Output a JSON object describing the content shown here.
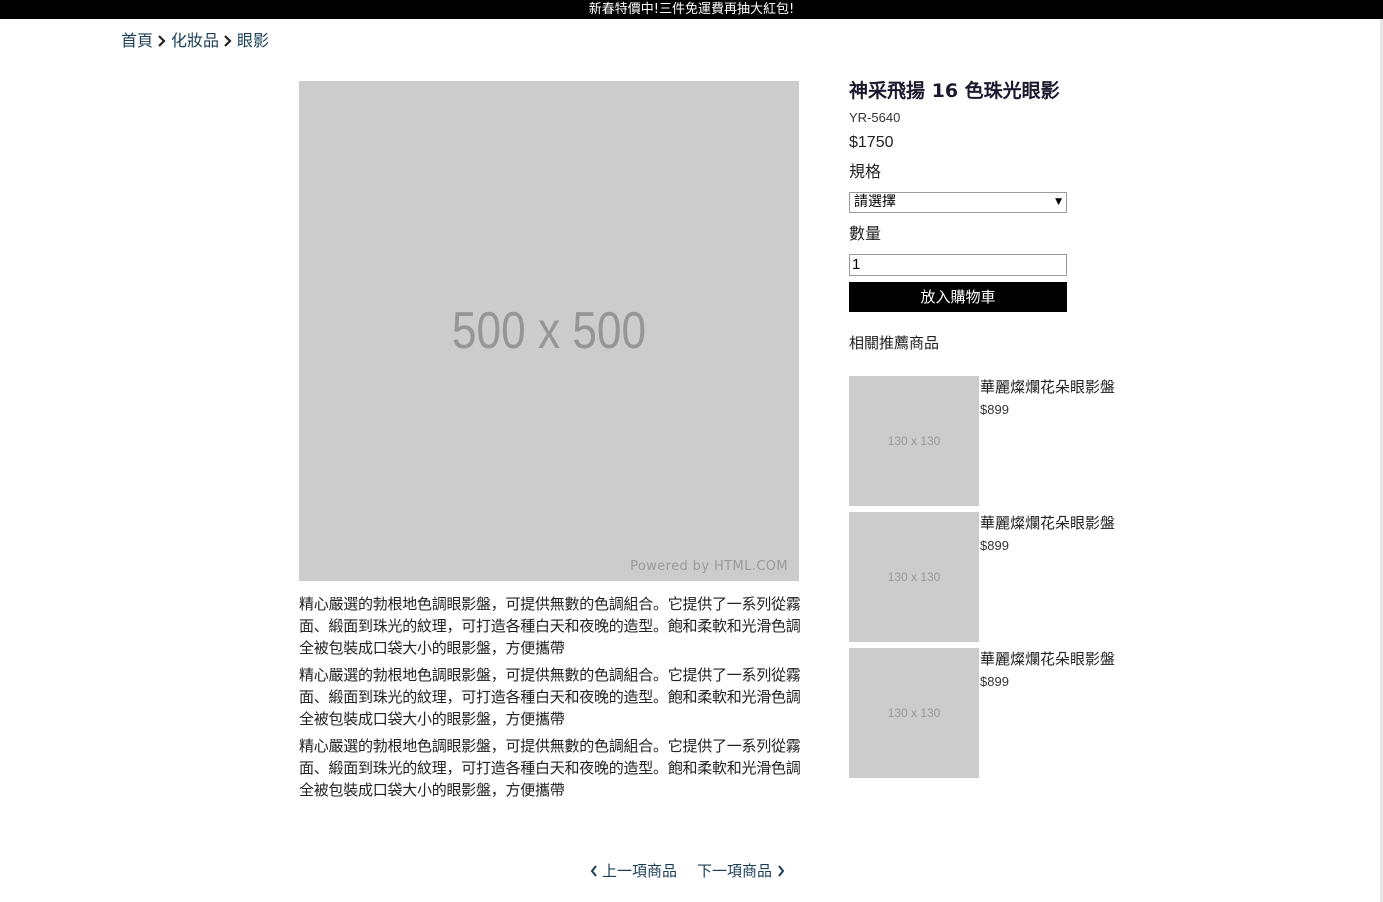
{
  "announcement": "新春特價中!三件免運費再抽大紅包!",
  "breadcrumb": {
    "items": [
      "首頁",
      "化妝品",
      "眼影"
    ]
  },
  "main_image": {
    "placeholder": "500 x 500",
    "watermark": "Powered by HTML.COM"
  },
  "description": [
    "精心嚴選的勃根地色調眼影盤，可提供無數的色調組合。它提供了一系列從霧面、緞面到珠光的紋理，可打造各種白天和夜晚的造型。飽和柔軟和光滑色調全被包裝成口袋大小的眼影盤，方便攜帶",
    "精心嚴選的勃根地色調眼影盤，可提供無數的色調組合。它提供了一系列從霧面、緞面到珠光的紋理，可打造各種白天和夜晚的造型。飽和柔軟和光滑色調全被包裝成口袋大小的眼影盤，方便攜帶",
    "精心嚴選的勃根地色調眼影盤，可提供無數的色調組合。它提供了一系列從霧面、緞面到珠光的紋理，可打造各種白天和夜晚的造型。飽和柔軟和光滑色調全被包裝成口袋大小的眼影盤，方便攜帶"
  ],
  "product": {
    "title": "神采飛揚 16 色珠光眼影",
    "sku": "YR-5640",
    "price": "$1750",
    "spec_label": "規格",
    "spec_selected": "請選擇",
    "qty_label": "數量",
    "qty_value": "1",
    "add_to_cart": "放入購物車"
  },
  "related": {
    "title": "相關推薦商品",
    "items": [
      {
        "thumb": "130 x 130",
        "name": "華麗燦爛花朵眼影盤",
        "price": "$899"
      },
      {
        "thumb": "130 x 130",
        "name": "華麗燦爛花朵眼影盤",
        "price": "$899"
      },
      {
        "thumb": "130 x 130",
        "name": "華麗燦爛花朵眼影盤",
        "price": "$899"
      }
    ]
  },
  "pager": {
    "prev": "上一項商品",
    "next": "下一項商品"
  },
  "icons": {
    "breadcrumb_separator": "chevron-right-icon",
    "pager_prev": "chevron-left-icon",
    "pager_next": "chevron-right-icon",
    "select_arrow": "caret-down-icon"
  },
  "colors": {
    "topbar": "#000000",
    "link": "#1b3f57",
    "placeholder": "#cccccc",
    "button": "#000000"
  }
}
